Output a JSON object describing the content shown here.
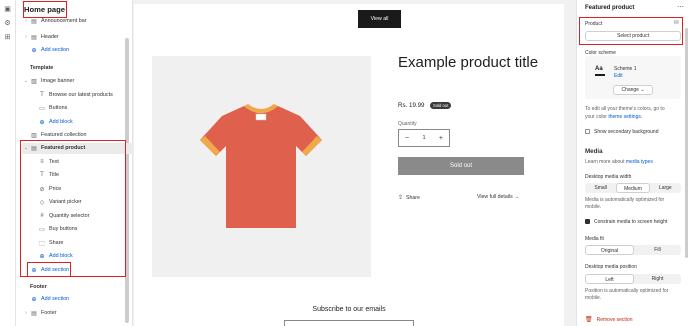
{
  "sidebar": {
    "title": "Home page",
    "items": [
      {
        "label": "Announcement bar",
        "icon": "layout-icon"
      },
      {
        "label": "Header",
        "icon": "layout-icon"
      },
      {
        "label": "Add section"
      },
      {
        "label": "Template"
      },
      {
        "label": "Image banner",
        "icon": "image-icon"
      },
      {
        "label": "Browse our latest products",
        "icon": "text-icon"
      },
      {
        "label": "Buttons",
        "icon": "button-icon"
      },
      {
        "label": "Add block"
      },
      {
        "label": "Featured collection",
        "icon": "collection-icon"
      },
      {
        "label": "Featured product",
        "icon": "product-icon"
      },
      {
        "label": "Text",
        "icon": "text-icon"
      },
      {
        "label": "Title",
        "icon": "text-icon"
      },
      {
        "label": "Price",
        "icon": "price-icon"
      },
      {
        "label": "Variant picker",
        "icon": "variant-icon"
      },
      {
        "label": "Quantity selector",
        "icon": "hash-icon"
      },
      {
        "label": "Buy buttons",
        "icon": "button-icon"
      },
      {
        "label": "Share",
        "icon": "share-icon"
      },
      {
        "label": "Add block"
      },
      {
        "label": "Add section"
      },
      {
        "label": "Footer"
      },
      {
        "label": "Add section"
      },
      {
        "label": "Footer",
        "icon": "layout-icon"
      }
    ]
  },
  "canvas": {
    "view_all": "View all",
    "product_title": "Example product title",
    "price": "Rs. 19.99",
    "sold_badge": "Sold out",
    "quantity_label": "Quantity",
    "quantity_value": "1",
    "minus": "−",
    "plus": "+",
    "sold_button": "Sold out",
    "share": "Share",
    "view_full": "View full details →",
    "subscribe": "Subscribe to our emails"
  },
  "panel": {
    "title": "Featured product",
    "product_label": "Product",
    "select_product": "Select product",
    "color_scheme": "Color scheme",
    "scheme_name": "Scheme 1",
    "scheme_edit": "Edit",
    "scheme_swatch": "Aa",
    "change": "Change",
    "theme_help_1": "To edit all your theme's colors, go to",
    "theme_help_2": "your color",
    "theme_help_link": "theme settings.",
    "secondary_bg": "Show secondary background",
    "media_heading": "Media",
    "media_help": "Learn more about",
    "media_help_link": "media types",
    "desktop_width": "Desktop media width",
    "width_opts": [
      "Small",
      "Medium",
      "Large"
    ],
    "width_note_1": "Media is automatically optimized for",
    "width_note_2": "mobile.",
    "constrain": "Constrain media to screen height",
    "media_fit": "Media fit",
    "fit_opts": [
      "Original",
      "Fill"
    ],
    "desktop_position": "Desktop media position",
    "position_opts": [
      "Left",
      "Right"
    ],
    "position_note_1": "Position is automatically optimized for",
    "position_note_2": "mobile.",
    "remove": "Remove section"
  },
  "colors": {
    "accent": "#005bd3",
    "annotation": "#e02020",
    "shirt": "#e0604e",
    "shirt_trim": "#f0a948"
  }
}
